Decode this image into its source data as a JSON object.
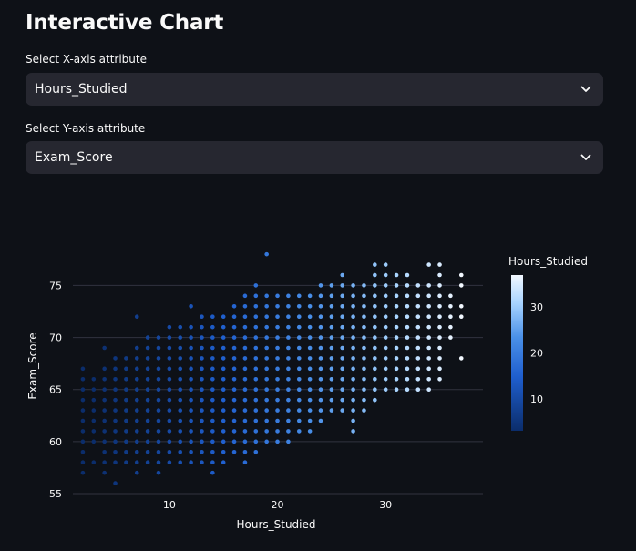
{
  "page": {
    "title": "Interactive Chart"
  },
  "x_select": {
    "label": "Select X-axis attribute",
    "value": "Hours_Studied",
    "icon": "chevron-down-icon"
  },
  "y_select": {
    "label": "Select Y-axis attribute",
    "value": "Exam_Score",
    "icon": "chevron-down-icon"
  },
  "chart_data": {
    "type": "scatter",
    "xlabel": "Hours_Studied",
    "ylabel": "Exam_Score",
    "x_ticks": [
      10,
      20,
      30
    ],
    "y_ticks": [
      55,
      60,
      65,
      70,
      75
    ],
    "xlim": [
      1.5,
      39
    ],
    "ylim": [
      55,
      78.8
    ],
    "grid": "horizontal",
    "color_by": "Hours_Studied",
    "colorbar": {
      "title": "Hours_Studied",
      "ticks": [
        10,
        20,
        30
      ],
      "range": [
        3,
        37
      ],
      "colors": [
        "#0b2d6b",
        "#1f5fcf",
        "#4a90e8",
        "#a8d4ff",
        "#f2f8ff"
      ]
    },
    "points": [
      [
        2,
        57
      ],
      [
        2,
        58
      ],
      [
        2,
        59
      ],
      [
        2,
        60
      ],
      [
        2,
        61
      ],
      [
        2,
        62
      ],
      [
        2,
        63
      ],
      [
        2,
        64
      ],
      [
        2,
        65
      ],
      [
        2,
        66
      ],
      [
        2,
        67
      ],
      [
        3,
        58
      ],
      [
        3,
        60
      ],
      [
        3,
        61
      ],
      [
        3,
        62
      ],
      [
        3,
        63
      ],
      [
        3,
        64
      ],
      [
        3,
        65
      ],
      [
        3,
        66
      ],
      [
        4,
        57
      ],
      [
        4,
        58
      ],
      [
        4,
        59
      ],
      [
        4,
        60
      ],
      [
        4,
        61
      ],
      [
        4,
        62
      ],
      [
        4,
        63
      ],
      [
        4,
        64
      ],
      [
        4,
        65
      ],
      [
        4,
        66
      ],
      [
        4,
        67
      ],
      [
        4,
        69
      ],
      [
        5,
        56
      ],
      [
        5,
        58
      ],
      [
        5,
        59
      ],
      [
        5,
        60
      ],
      [
        5,
        61
      ],
      [
        5,
        62
      ],
      [
        5,
        63
      ],
      [
        5,
        64
      ],
      [
        5,
        65
      ],
      [
        5,
        66
      ],
      [
        5,
        67
      ],
      [
        5,
        68
      ],
      [
        6,
        58
      ],
      [
        6,
        59
      ],
      [
        6,
        60
      ],
      [
        6,
        61
      ],
      [
        6,
        62
      ],
      [
        6,
        63
      ],
      [
        6,
        64
      ],
      [
        6,
        65
      ],
      [
        6,
        66
      ],
      [
        6,
        67
      ],
      [
        6,
        68
      ],
      [
        7,
        57
      ],
      [
        7,
        58
      ],
      [
        7,
        59
      ],
      [
        7,
        60
      ],
      [
        7,
        61
      ],
      [
        7,
        62
      ],
      [
        7,
        63
      ],
      [
        7,
        64
      ],
      [
        7,
        65
      ],
      [
        7,
        66
      ],
      [
        7,
        67
      ],
      [
        7,
        68
      ],
      [
        7,
        69
      ],
      [
        7,
        72
      ],
      [
        8,
        58
      ],
      [
        8,
        59
      ],
      [
        8,
        60
      ],
      [
        8,
        61
      ],
      [
        8,
        62
      ],
      [
        8,
        63
      ],
      [
        8,
        64
      ],
      [
        8,
        65
      ],
      [
        8,
        66
      ],
      [
        8,
        67
      ],
      [
        8,
        68
      ],
      [
        8,
        69
      ],
      [
        8,
        70
      ],
      [
        9,
        57
      ],
      [
        9,
        58
      ],
      [
        9,
        59
      ],
      [
        9,
        60
      ],
      [
        9,
        61
      ],
      [
        9,
        62
      ],
      [
        9,
        63
      ],
      [
        9,
        64
      ],
      [
        9,
        65
      ],
      [
        9,
        66
      ],
      [
        9,
        67
      ],
      [
        9,
        68
      ],
      [
        9,
        69
      ],
      [
        9,
        70
      ],
      [
        10,
        58
      ],
      [
        10,
        59
      ],
      [
        10,
        60
      ],
      [
        10,
        61
      ],
      [
        10,
        62
      ],
      [
        10,
        63
      ],
      [
        10,
        64
      ],
      [
        10,
        65
      ],
      [
        10,
        66
      ],
      [
        10,
        67
      ],
      [
        10,
        68
      ],
      [
        10,
        69
      ],
      [
        10,
        70
      ],
      [
        10,
        71
      ],
      [
        11,
        58
      ],
      [
        11,
        59
      ],
      [
        11,
        60
      ],
      [
        11,
        61
      ],
      [
        11,
        62
      ],
      [
        11,
        63
      ],
      [
        11,
        64
      ],
      [
        11,
        65
      ],
      [
        11,
        66
      ],
      [
        11,
        67
      ],
      [
        11,
        68
      ],
      [
        11,
        69
      ],
      [
        11,
        70
      ],
      [
        11,
        71
      ],
      [
        12,
        58
      ],
      [
        12,
        59
      ],
      [
        12,
        60
      ],
      [
        12,
        61
      ],
      [
        12,
        62
      ],
      [
        12,
        63
      ],
      [
        12,
        64
      ],
      [
        12,
        65
      ],
      [
        12,
        66
      ],
      [
        12,
        67
      ],
      [
        12,
        68
      ],
      [
        12,
        69
      ],
      [
        12,
        70
      ],
      [
        12,
        71
      ],
      [
        12,
        73
      ],
      [
        13,
        58
      ],
      [
        13,
        59
      ],
      [
        13,
        60
      ],
      [
        13,
        61
      ],
      [
        13,
        62
      ],
      [
        13,
        63
      ],
      [
        13,
        64
      ],
      [
        13,
        65
      ],
      [
        13,
        66
      ],
      [
        13,
        67
      ],
      [
        13,
        68
      ],
      [
        13,
        69
      ],
      [
        13,
        70
      ],
      [
        13,
        71
      ],
      [
        13,
        72
      ],
      [
        14,
        57
      ],
      [
        14,
        58
      ],
      [
        14,
        59
      ],
      [
        14,
        60
      ],
      [
        14,
        61
      ],
      [
        14,
        62
      ],
      [
        14,
        63
      ],
      [
        14,
        64
      ],
      [
        14,
        65
      ],
      [
        14,
        66
      ],
      [
        14,
        67
      ],
      [
        14,
        68
      ],
      [
        14,
        69
      ],
      [
        14,
        70
      ],
      [
        14,
        71
      ],
      [
        14,
        72
      ],
      [
        15,
        58
      ],
      [
        15,
        59
      ],
      [
        15,
        60
      ],
      [
        15,
        61
      ],
      [
        15,
        62
      ],
      [
        15,
        63
      ],
      [
        15,
        64
      ],
      [
        15,
        65
      ],
      [
        15,
        66
      ],
      [
        15,
        67
      ],
      [
        15,
        68
      ],
      [
        15,
        69
      ],
      [
        15,
        70
      ],
      [
        15,
        71
      ],
      [
        15,
        72
      ],
      [
        16,
        59
      ],
      [
        16,
        60
      ],
      [
        16,
        61
      ],
      [
        16,
        62
      ],
      [
        16,
        63
      ],
      [
        16,
        64
      ],
      [
        16,
        65
      ],
      [
        16,
        66
      ],
      [
        16,
        67
      ],
      [
        16,
        68
      ],
      [
        16,
        69
      ],
      [
        16,
        70
      ],
      [
        16,
        71
      ],
      [
        16,
        72
      ],
      [
        16,
        73
      ],
      [
        17,
        58
      ],
      [
        17,
        59
      ],
      [
        17,
        60
      ],
      [
        17,
        61
      ],
      [
        17,
        62
      ],
      [
        17,
        63
      ],
      [
        17,
        64
      ],
      [
        17,
        65
      ],
      [
        17,
        66
      ],
      [
        17,
        67
      ],
      [
        17,
        68
      ],
      [
        17,
        69
      ],
      [
        17,
        70
      ],
      [
        17,
        71
      ],
      [
        17,
        72
      ],
      [
        17,
        73
      ],
      [
        17,
        74
      ],
      [
        18,
        59
      ],
      [
        18,
        60
      ],
      [
        18,
        61
      ],
      [
        18,
        62
      ],
      [
        18,
        63
      ],
      [
        18,
        64
      ],
      [
        18,
        65
      ],
      [
        18,
        66
      ],
      [
        18,
        67
      ],
      [
        18,
        68
      ],
      [
        18,
        69
      ],
      [
        18,
        70
      ],
      [
        18,
        71
      ],
      [
        18,
        72
      ],
      [
        18,
        73
      ],
      [
        18,
        74
      ],
      [
        18,
        75
      ],
      [
        19,
        60
      ],
      [
        19,
        61
      ],
      [
        19,
        62
      ],
      [
        19,
        63
      ],
      [
        19,
        64
      ],
      [
        19,
        65
      ],
      [
        19,
        66
      ],
      [
        19,
        67
      ],
      [
        19,
        68
      ],
      [
        19,
        69
      ],
      [
        19,
        70
      ],
      [
        19,
        71
      ],
      [
        19,
        72
      ],
      [
        19,
        73
      ],
      [
        19,
        74
      ],
      [
        19,
        78
      ],
      [
        20,
        60
      ],
      [
        20,
        61
      ],
      [
        20,
        62
      ],
      [
        20,
        63
      ],
      [
        20,
        64
      ],
      [
        20,
        65
      ],
      [
        20,
        66
      ],
      [
        20,
        67
      ],
      [
        20,
        68
      ],
      [
        20,
        69
      ],
      [
        20,
        70
      ],
      [
        20,
        71
      ],
      [
        20,
        72
      ],
      [
        20,
        73
      ],
      [
        20,
        74
      ],
      [
        21,
        60
      ],
      [
        21,
        61
      ],
      [
        21,
        62
      ],
      [
        21,
        63
      ],
      [
        21,
        64
      ],
      [
        21,
        65
      ],
      [
        21,
        66
      ],
      [
        21,
        67
      ],
      [
        21,
        68
      ],
      [
        21,
        69
      ],
      [
        21,
        70
      ],
      [
        21,
        71
      ],
      [
        21,
        72
      ],
      [
        21,
        73
      ],
      [
        21,
        74
      ],
      [
        22,
        61
      ],
      [
        22,
        62
      ],
      [
        22,
        63
      ],
      [
        22,
        64
      ],
      [
        22,
        65
      ],
      [
        22,
        66
      ],
      [
        22,
        67
      ],
      [
        22,
        68
      ],
      [
        22,
        69
      ],
      [
        22,
        70
      ],
      [
        22,
        71
      ],
      [
        22,
        72
      ],
      [
        22,
        73
      ],
      [
        22,
        74
      ],
      [
        23,
        61
      ],
      [
        23,
        62
      ],
      [
        23,
        63
      ],
      [
        23,
        64
      ],
      [
        23,
        65
      ],
      [
        23,
        66
      ],
      [
        23,
        67
      ],
      [
        23,
        68
      ],
      [
        23,
        69
      ],
      [
        23,
        70
      ],
      [
        23,
        71
      ],
      [
        23,
        72
      ],
      [
        23,
        73
      ],
      [
        23,
        74
      ],
      [
        24,
        62
      ],
      [
        24,
        63
      ],
      [
        24,
        64
      ],
      [
        24,
        65
      ],
      [
        24,
        66
      ],
      [
        24,
        67
      ],
      [
        24,
        68
      ],
      [
        24,
        69
      ],
      [
        24,
        70
      ],
      [
        24,
        71
      ],
      [
        24,
        72
      ],
      [
        24,
        73
      ],
      [
        24,
        74
      ],
      [
        24,
        75
      ],
      [
        25,
        63
      ],
      [
        25,
        64
      ],
      [
        25,
        65
      ],
      [
        25,
        66
      ],
      [
        25,
        67
      ],
      [
        25,
        68
      ],
      [
        25,
        69
      ],
      [
        25,
        70
      ],
      [
        25,
        71
      ],
      [
        25,
        72
      ],
      [
        25,
        73
      ],
      [
        25,
        74
      ],
      [
        25,
        75
      ],
      [
        26,
        63
      ],
      [
        26,
        64
      ],
      [
        26,
        65
      ],
      [
        26,
        66
      ],
      [
        26,
        67
      ],
      [
        26,
        68
      ],
      [
        26,
        69
      ],
      [
        26,
        70
      ],
      [
        26,
        71
      ],
      [
        26,
        72
      ],
      [
        26,
        73
      ],
      [
        26,
        74
      ],
      [
        26,
        75
      ],
      [
        26,
        76
      ],
      [
        27,
        61
      ],
      [
        27,
        62
      ],
      [
        27,
        63
      ],
      [
        27,
        64
      ],
      [
        27,
        65
      ],
      [
        27,
        66
      ],
      [
        27,
        67
      ],
      [
        27,
        68
      ],
      [
        27,
        69
      ],
      [
        27,
        70
      ],
      [
        27,
        71
      ],
      [
        27,
        72
      ],
      [
        27,
        73
      ],
      [
        27,
        74
      ],
      [
        27,
        75
      ],
      [
        28,
        63
      ],
      [
        28,
        64
      ],
      [
        28,
        65
      ],
      [
        28,
        66
      ],
      [
        28,
        67
      ],
      [
        28,
        68
      ],
      [
        28,
        69
      ],
      [
        28,
        70
      ],
      [
        28,
        71
      ],
      [
        28,
        72
      ],
      [
        28,
        73
      ],
      [
        28,
        74
      ],
      [
        28,
        75
      ],
      [
        29,
        64
      ],
      [
        29,
        65
      ],
      [
        29,
        66
      ],
      [
        29,
        67
      ],
      [
        29,
        68
      ],
      [
        29,
        69
      ],
      [
        29,
        70
      ],
      [
        29,
        71
      ],
      [
        29,
        72
      ],
      [
        29,
        73
      ],
      [
        29,
        74
      ],
      [
        29,
        75
      ],
      [
        29,
        76
      ],
      [
        29,
        77
      ],
      [
        30,
        65
      ],
      [
        30,
        66
      ],
      [
        30,
        67
      ],
      [
        30,
        68
      ],
      [
        30,
        69
      ],
      [
        30,
        70
      ],
      [
        30,
        71
      ],
      [
        30,
        72
      ],
      [
        30,
        73
      ],
      [
        30,
        74
      ],
      [
        30,
        75
      ],
      [
        30,
        76
      ],
      [
        30,
        77
      ],
      [
        31,
        65
      ],
      [
        31,
        66
      ],
      [
        31,
        67
      ],
      [
        31,
        68
      ],
      [
        31,
        69
      ],
      [
        31,
        70
      ],
      [
        31,
        71
      ],
      [
        31,
        72
      ],
      [
        31,
        73
      ],
      [
        31,
        74
      ],
      [
        31,
        75
      ],
      [
        31,
        76
      ],
      [
        32,
        65
      ],
      [
        32,
        66
      ],
      [
        32,
        67
      ],
      [
        32,
        68
      ],
      [
        32,
        69
      ],
      [
        32,
        70
      ],
      [
        32,
        71
      ],
      [
        32,
        72
      ],
      [
        32,
        73
      ],
      [
        32,
        74
      ],
      [
        32,
        75
      ],
      [
        32,
        76
      ],
      [
        33,
        65
      ],
      [
        33,
        66
      ],
      [
        33,
        67
      ],
      [
        33,
        68
      ],
      [
        33,
        69
      ],
      [
        33,
        70
      ],
      [
        33,
        71
      ],
      [
        33,
        72
      ],
      [
        33,
        73
      ],
      [
        33,
        74
      ],
      [
        33,
        75
      ],
      [
        34,
        65
      ],
      [
        34,
        66
      ],
      [
        34,
        67
      ],
      [
        34,
        68
      ],
      [
        34,
        69
      ],
      [
        34,
        70
      ],
      [
        34,
        71
      ],
      [
        34,
        72
      ],
      [
        34,
        73
      ],
      [
        34,
        74
      ],
      [
        34,
        75
      ],
      [
        34,
        77
      ],
      [
        35,
        66
      ],
      [
        35,
        67
      ],
      [
        35,
        68
      ],
      [
        35,
        69
      ],
      [
        35,
        70
      ],
      [
        35,
        71
      ],
      [
        35,
        72
      ],
      [
        35,
        73
      ],
      [
        35,
        74
      ],
      [
        35,
        75
      ],
      [
        35,
        76
      ],
      [
        35,
        77
      ],
      [
        36,
        70
      ],
      [
        36,
        71
      ],
      [
        36,
        72
      ],
      [
        36,
        73
      ],
      [
        36,
        74
      ],
      [
        37,
        68
      ],
      [
        37,
        72
      ],
      [
        37,
        73
      ],
      [
        37,
        75
      ],
      [
        37,
        76
      ]
    ]
  }
}
